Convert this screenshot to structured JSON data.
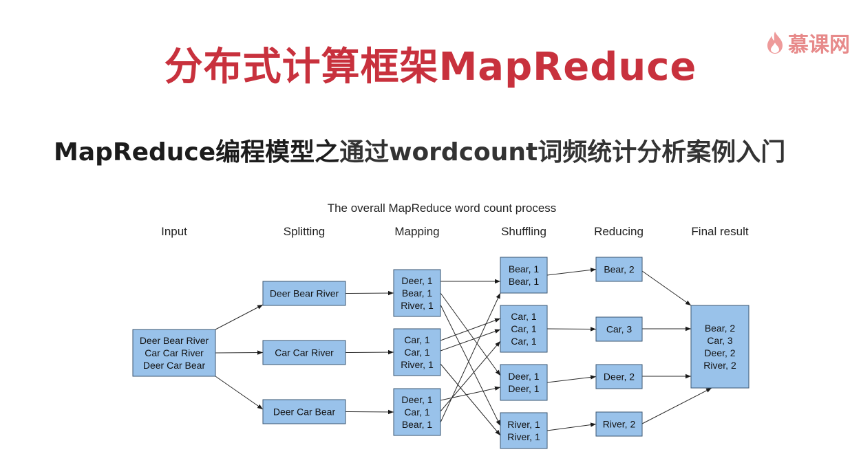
{
  "header": {
    "title": "分布式计算框架MapReduce",
    "subtitle_part1": "MapReduce编程模型之",
    "subtitle_part2": "通过wordcount词频统计分析案例入门",
    "logo_text": "慕课网"
  },
  "diagram": {
    "title": "The overall MapReduce word count process",
    "stages": [
      "Input",
      "Splitting",
      "Mapping",
      "Shuffling",
      "Reducing",
      "Final result"
    ],
    "nodes": [
      {
        "id": "input",
        "stage": 0,
        "lines": [
          "Deer Bear River",
          "Car Car River",
          "Deer Car Bear"
        ]
      },
      {
        "id": "split1",
        "stage": 1,
        "lines": [
          "Deer Bear River"
        ]
      },
      {
        "id": "split2",
        "stage": 1,
        "lines": [
          "Car Car River"
        ]
      },
      {
        "id": "split3",
        "stage": 1,
        "lines": [
          "Deer Car Bear"
        ]
      },
      {
        "id": "map1",
        "stage": 2,
        "lines": [
          "Deer, 1",
          "Bear, 1",
          "River, 1"
        ]
      },
      {
        "id": "map2",
        "stage": 2,
        "lines": [
          "Car, 1",
          "Car, 1",
          "River, 1"
        ]
      },
      {
        "id": "map3",
        "stage": 2,
        "lines": [
          "Deer, 1",
          "Car, 1",
          "Bear, 1"
        ]
      },
      {
        "id": "shuf1",
        "stage": 3,
        "lines": [
          "Bear, 1",
          "Bear, 1"
        ]
      },
      {
        "id": "shuf2",
        "stage": 3,
        "lines": [
          "Car, 1",
          "Car, 1",
          "Car, 1"
        ]
      },
      {
        "id": "shuf3",
        "stage": 3,
        "lines": [
          "Deer, 1",
          "Deer, 1"
        ]
      },
      {
        "id": "shuf4",
        "stage": 3,
        "lines": [
          "River, 1",
          "River, 1"
        ]
      },
      {
        "id": "red1",
        "stage": 4,
        "lines": [
          "Bear, 2"
        ]
      },
      {
        "id": "red2",
        "stage": 4,
        "lines": [
          "Car, 3"
        ]
      },
      {
        "id": "red3",
        "stage": 4,
        "lines": [
          "Deer, 2"
        ]
      },
      {
        "id": "red4",
        "stage": 4,
        "lines": [
          "River, 2"
        ]
      },
      {
        "id": "final",
        "stage": 5,
        "lines": [
          "Bear, 2",
          "Car, 3",
          "Deer, 2",
          "River, 2"
        ]
      }
    ],
    "edges": [
      [
        "input",
        "split1"
      ],
      [
        "input",
        "split2"
      ],
      [
        "input",
        "split3"
      ],
      [
        "split1",
        "map1"
      ],
      [
        "split2",
        "map2"
      ],
      [
        "split3",
        "map3"
      ],
      [
        "map1",
        "shuf1"
      ],
      [
        "map1",
        "shuf3"
      ],
      [
        "map1",
        "shuf4"
      ],
      [
        "map2",
        "shuf2"
      ],
      [
        "map2",
        "shuf2"
      ],
      [
        "map2",
        "shuf4"
      ],
      [
        "map3",
        "shuf3"
      ],
      [
        "map3",
        "shuf2"
      ],
      [
        "map3",
        "shuf1"
      ],
      [
        "shuf1",
        "red1"
      ],
      [
        "shuf2",
        "red2"
      ],
      [
        "shuf3",
        "red3"
      ],
      [
        "shuf4",
        "red4"
      ],
      [
        "red1",
        "final"
      ],
      [
        "red2",
        "final"
      ],
      [
        "red3",
        "final"
      ],
      [
        "red4",
        "final"
      ]
    ]
  }
}
